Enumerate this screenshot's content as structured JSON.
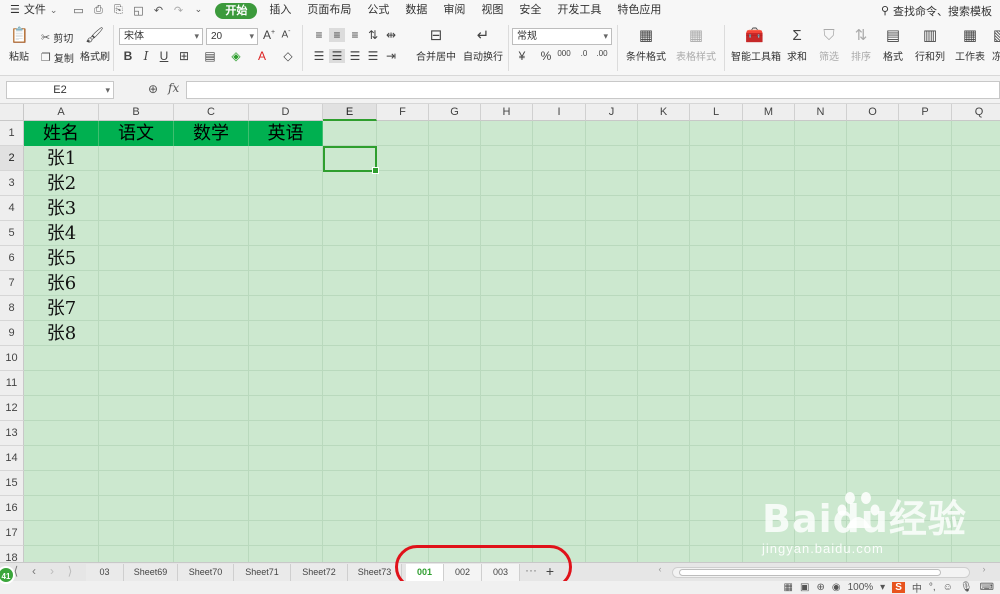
{
  "menubar": {
    "file_label": "文件",
    "tabs": [
      "开始",
      "插入",
      "页面布局",
      "公式",
      "数据",
      "审阅",
      "视图",
      "安全",
      "开发工具",
      "特色应用"
    ],
    "active_tab": "开始",
    "search_label": "查找命令、搜索模板"
  },
  "ribbon": {
    "paste": "粘贴",
    "cut": "剪切",
    "copy": "复制",
    "format_painter": "格式刷",
    "font_name": "宋体",
    "font_size": "20",
    "merge_center": "合并居中",
    "wrap_text": "自动换行",
    "number_format": "常规",
    "conditional_format": "条件格式",
    "table_style": "表格样式",
    "smart_toolbox": "智能工具箱",
    "sum": "求和",
    "filter": "筛选",
    "sort": "排序",
    "format": "格式",
    "rows_cols": "行和列",
    "worksheet": "工作表",
    "freeze_partial": "冻"
  },
  "formula_bar": {
    "name_box": "E2",
    "fx_label": "fx",
    "formula_value": ""
  },
  "sheet": {
    "columns": [
      "A",
      "B",
      "C",
      "D",
      "E",
      "F",
      "G",
      "H",
      "I",
      "J",
      "K",
      "L",
      "M",
      "N",
      "O",
      "P",
      "Q"
    ],
    "selected_column": "E",
    "rows": [
      "1",
      "2",
      "3",
      "4",
      "5",
      "6",
      "7",
      "8",
      "9",
      "10",
      "11",
      "12",
      "13",
      "14",
      "15",
      "16",
      "17",
      "18"
    ],
    "selected_row": "2",
    "headers": [
      "姓名",
      "语文",
      "数学",
      "英语"
    ],
    "header_fill": "#00b050",
    "names": [
      "张1",
      "张2",
      "张3",
      "张4",
      "张5",
      "张6",
      "张7",
      "张8"
    ],
    "cell_background": "#cce8cf"
  },
  "sheet_tabs": {
    "tabs": [
      "03",
      "Sheet69",
      "Sheet70",
      "Sheet71",
      "Sheet72",
      "Sheet73",
      "001",
      "002",
      "003"
    ],
    "active": "001",
    "more": "···",
    "add": "+"
  },
  "statusbar": {
    "badge": "41",
    "zoom": "100%",
    "ime_label": "中"
  },
  "watermark": {
    "logo": "Baidu经验",
    "url": "jingyan.baidu.com"
  },
  "annotation": {
    "circle_color": "#e0121a"
  }
}
